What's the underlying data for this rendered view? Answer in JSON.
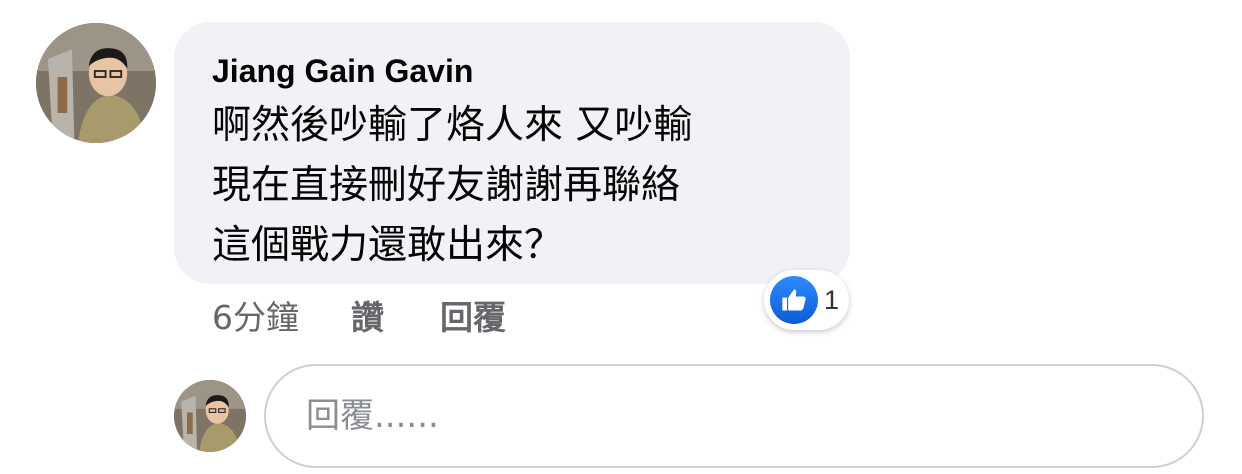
{
  "comment": {
    "author": "Jiang Gain Gavin",
    "lines": [
      "啊然後吵輸了烙人來 又吵輸",
      "現在直接刪好友謝謝再聯絡",
      "這個戰力還敢出來？"
    ],
    "reaction": {
      "icon": "thumbs-up-icon",
      "count": "1"
    },
    "time": "6分鐘",
    "like_label": "讚",
    "reply_label": "回覆"
  },
  "reply_box": {
    "placeholder": "回覆......"
  },
  "colors": {
    "bubble": "#f0f2f5",
    "meta_text": "#65676b",
    "like_blue": "#1877f2"
  }
}
